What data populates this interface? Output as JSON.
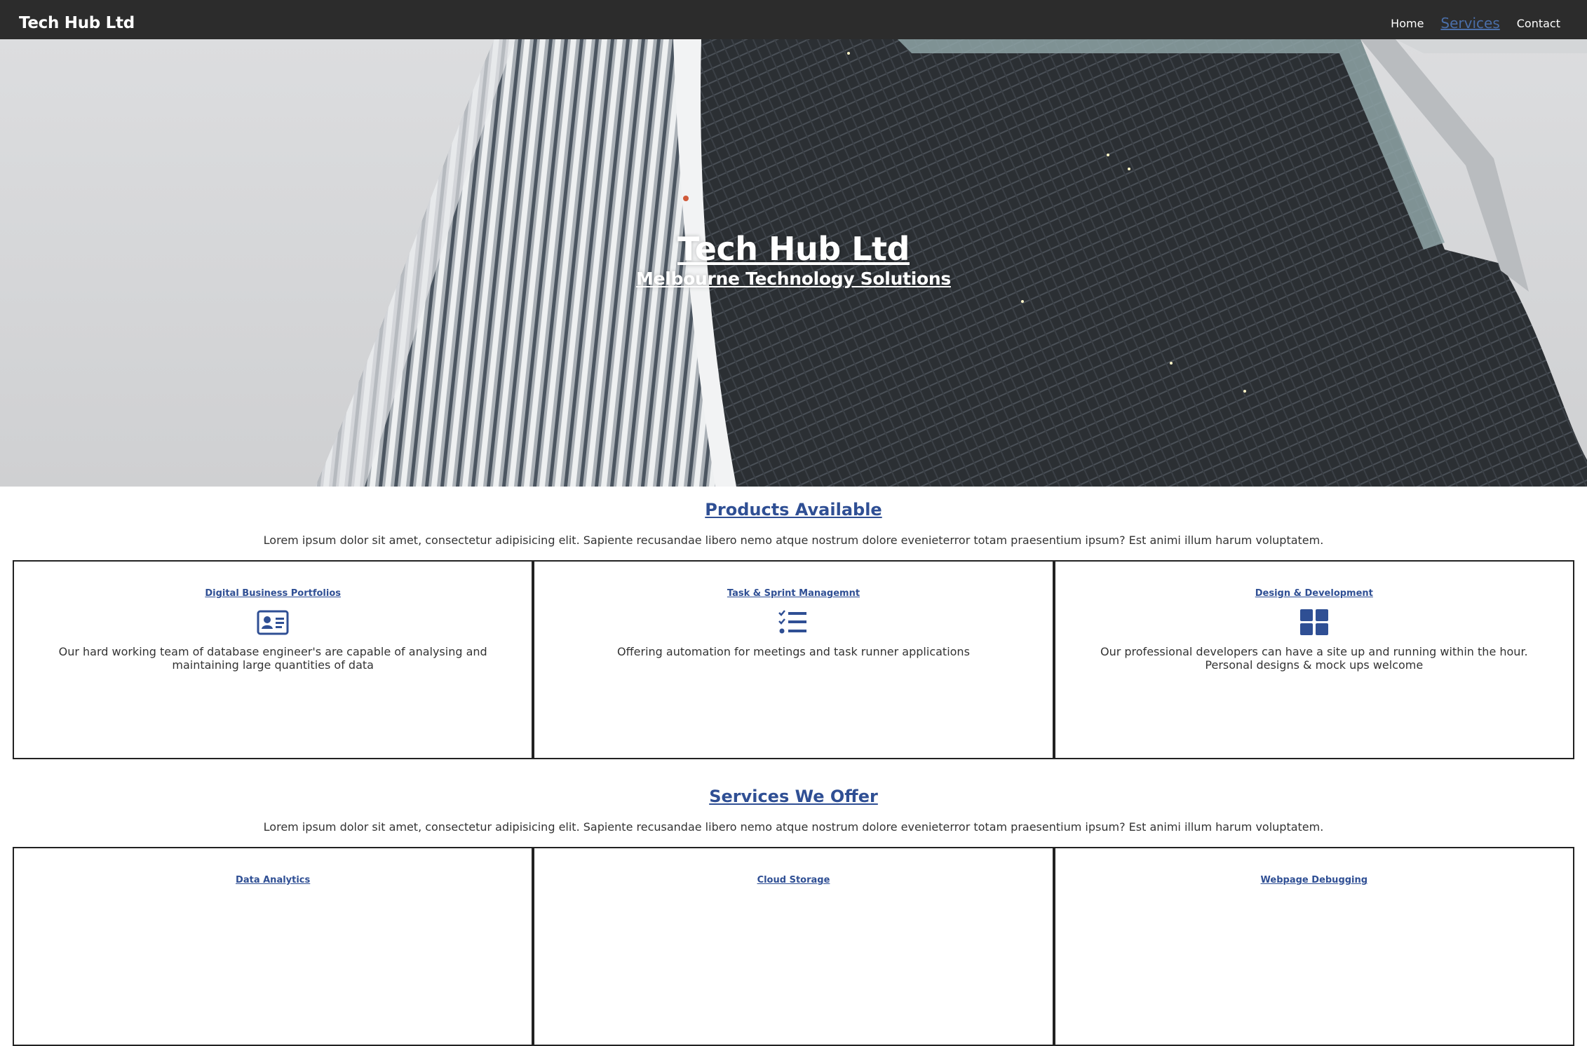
{
  "navbar": {
    "brand": "Tech Hub Ltd",
    "links": [
      {
        "label": "Home"
      },
      {
        "label": "Services"
      },
      {
        "label": "Contact"
      }
    ]
  },
  "hero": {
    "title": "Tech Hub Ltd",
    "subtitle": "Melbourne Technology Solutions"
  },
  "products": {
    "title": "Products Available",
    "description": "Lorem ipsum dolor sit amet, consectetur adipisicing elit. Sapiente recusandae libero nemo atque nostrum dolore evenieterror totam praesentium ipsum? Est animi illum harum voluptatem.",
    "cards": [
      {
        "title": "Digital Business Portfolios",
        "icon": "id-card-icon",
        "text": "Our hard working team of database engineer's are capable of analysing and maintaining large quantities of data"
      },
      {
        "title": "Task & Sprint Managemnt",
        "icon": "task-list-icon",
        "text": "Offering automation for meetings and task runner applications"
      },
      {
        "title": "Design & Development",
        "icon": "grid-icon",
        "text": "Our professional developers can have a site up and running within the hour. Personal designs & mock ups welcome"
      }
    ]
  },
  "services": {
    "title": "Services We Offer",
    "description": "Lorem ipsum dolor sit amet, consectetur adipisicing elit. Sapiente recusandae libero nemo atque nostrum dolore evenieterror totam praesentium ipsum? Est animi illum harum voluptatem.",
    "cards": [
      {
        "title": "Data Analytics"
      },
      {
        "title": "Cloud Storage"
      },
      {
        "title": "Webpage Debugging"
      }
    ]
  },
  "colors": {
    "navbar_bg": "#2c2c2c",
    "accent": "#2f4f94",
    "active_link": "#4a6ea8"
  }
}
